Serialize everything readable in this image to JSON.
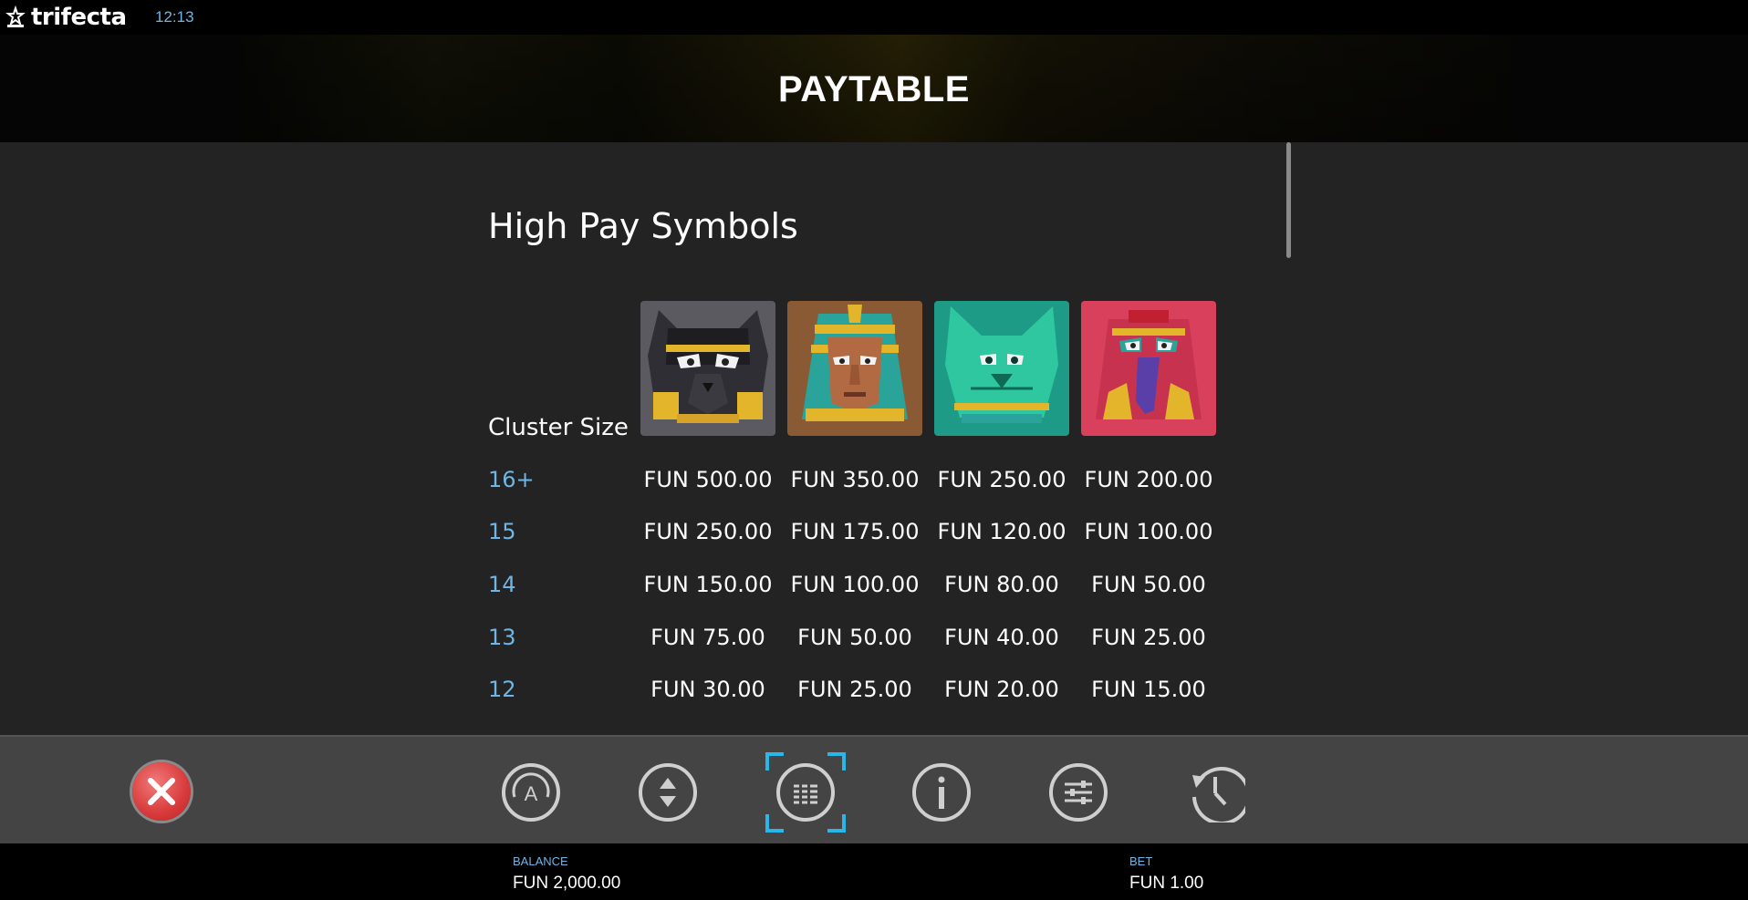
{
  "topbar": {
    "brand": "trifecta",
    "time": "12:13"
  },
  "header": {
    "title": "PAYTABLE"
  },
  "paytable": {
    "section_title": "High Pay Symbols",
    "cluster_label": "Cluster Size",
    "symbols": [
      "black-panther-mask-icon",
      "pharaoh-mask-icon",
      "green-cat-mask-icon",
      "red-bird-mask-icon"
    ],
    "rows": [
      {
        "size": "16+",
        "values": [
          "FUN 500.00",
          "FUN 350.00",
          "FUN 250.00",
          "FUN 200.00"
        ]
      },
      {
        "size": "15",
        "values": [
          "FUN 250.00",
          "FUN 175.00",
          "FUN 120.00",
          "FUN 100.00"
        ]
      },
      {
        "size": "14",
        "values": [
          "FUN 150.00",
          "FUN 100.00",
          "FUN 80.00",
          "FUN 50.00"
        ]
      },
      {
        "size": "13",
        "values": [
          "FUN 75.00",
          "FUN 50.00",
          "FUN 40.00",
          "FUN 25.00"
        ]
      },
      {
        "size": "12",
        "values": [
          "FUN 30.00",
          "FUN 25.00",
          "FUN 20.00",
          "FUN 15.00"
        ]
      }
    ]
  },
  "controls": {
    "items": [
      "close-icon",
      "autoplay-icon",
      "bet-adjust-icon",
      "paytable-icon",
      "info-icon",
      "settings-icon",
      "history-icon"
    ],
    "selected": "paytable-icon"
  },
  "footer": {
    "balance_label": "BALANCE",
    "balance_value": "FUN 2,000.00",
    "bet_label": "BET",
    "bet_value": "FUN 1.00"
  },
  "colors": {
    "accent": "#6fb6e6",
    "selection": "#29b6e8",
    "close": "#d83a3a"
  }
}
